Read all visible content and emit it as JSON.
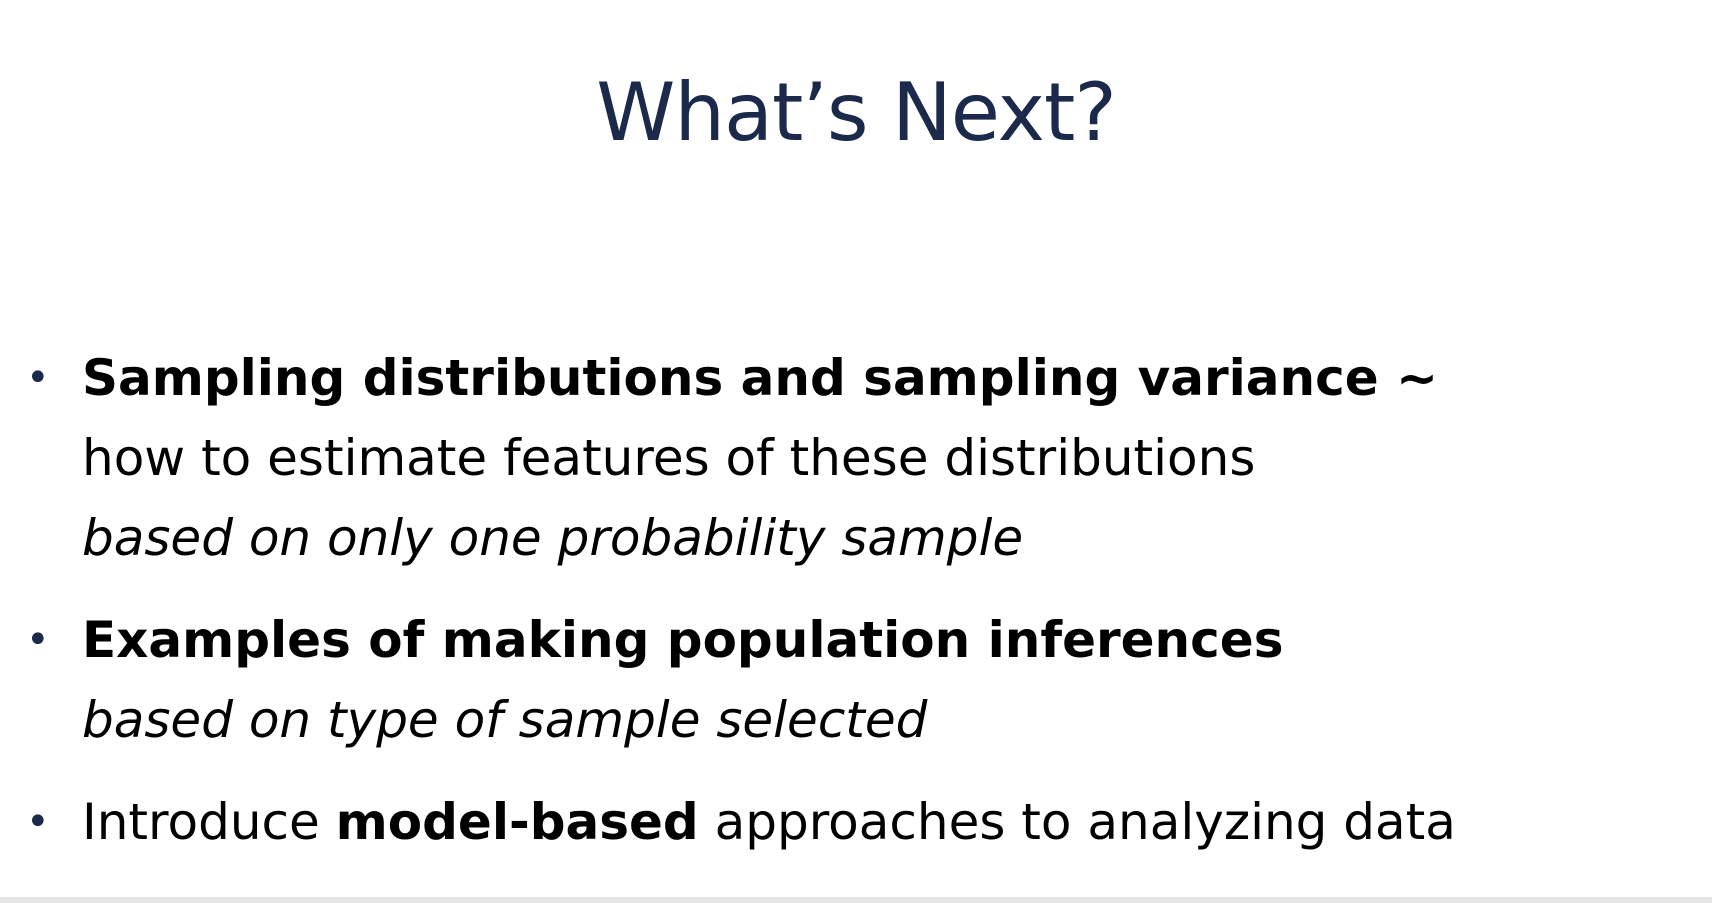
{
  "slide": {
    "title": "What’s Next?",
    "bullets": [
      {
        "head": "Sampling distributions and sampling variance ~",
        "line2": "how to estimate features of these distributions",
        "line3": "based on only one probability sample"
      },
      {
        "head": "Examples of making population inferences",
        "line2": "based on type of sample selected"
      },
      {
        "pre": "Introduce ",
        "bold": "model-based",
        "post": " approaches to analyzing data"
      }
    ],
    "bullet_glyph": "•"
  },
  "colors": {
    "title": "#1b2a4a",
    "text": "#000000",
    "background": "#ffffff"
  }
}
